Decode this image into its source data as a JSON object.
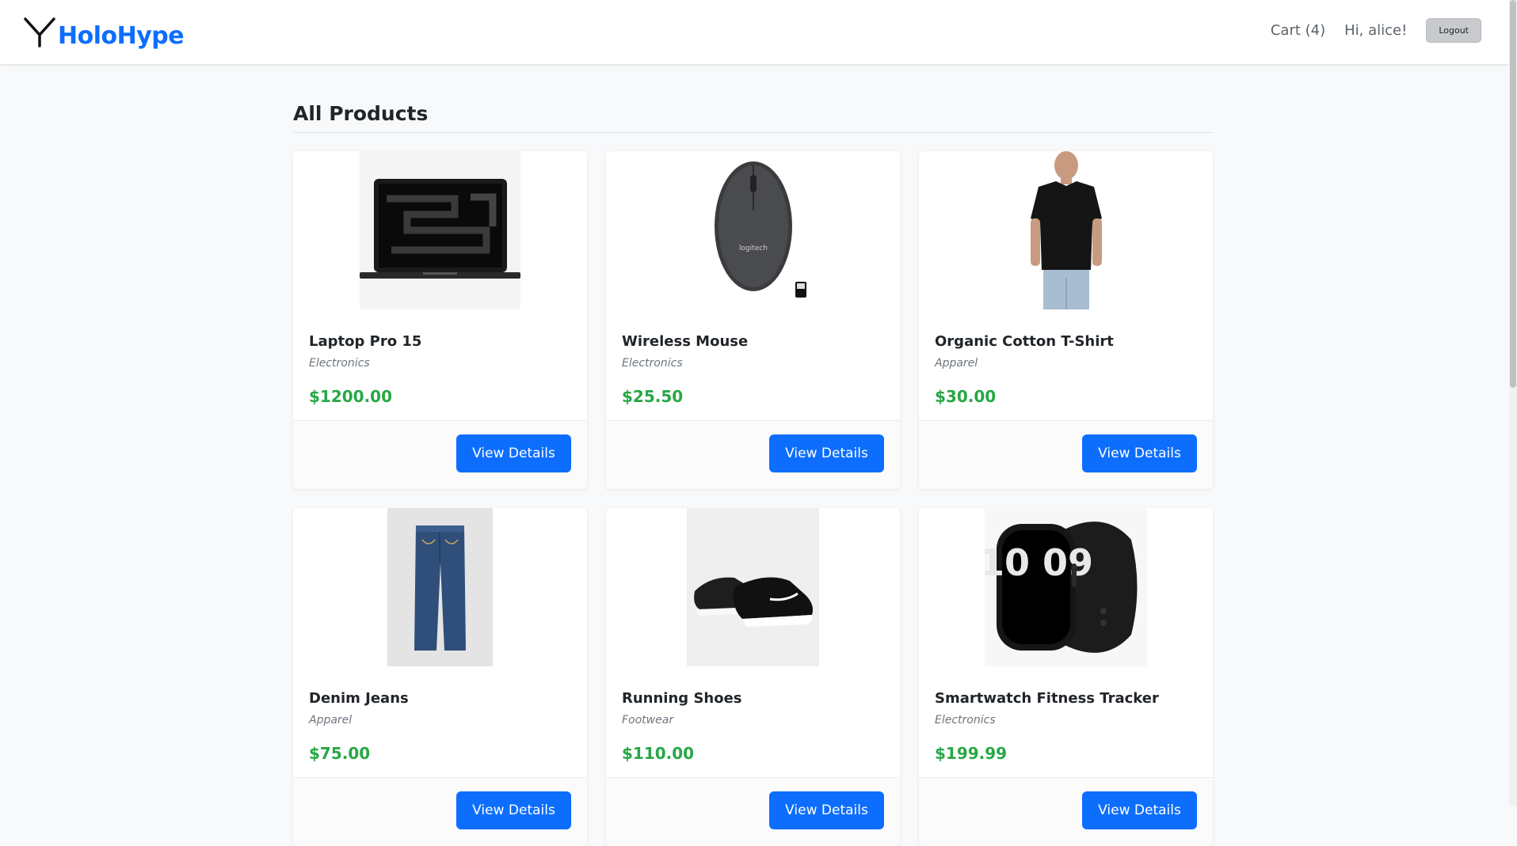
{
  "brand": {
    "name": "HoloHype",
    "accent": "#0d6efd"
  },
  "nav": {
    "cart_label": "Cart (4)",
    "greeting": "Hi, alice!",
    "logout_label": "Logout"
  },
  "main": {
    "title": "All Products",
    "products": [
      {
        "name": "Laptop Pro 15",
        "category": "Electronics",
        "price": "$1200.00",
        "button": "View Details",
        "image_icon": "laptop-image"
      },
      {
        "name": "Wireless Mouse",
        "category": "Electronics",
        "price": "$25.50",
        "button": "View Details",
        "image_icon": "mouse-image"
      },
      {
        "name": "Organic Cotton T-Shirt",
        "category": "Apparel",
        "price": "$30.00",
        "button": "View Details",
        "image_icon": "tshirt-image"
      },
      {
        "name": "Denim Jeans",
        "category": "Apparel",
        "price": "$75.00",
        "button": "View Details",
        "image_icon": "jeans-image"
      },
      {
        "name": "Running Shoes",
        "category": "Footwear",
        "price": "$110.00",
        "button": "View Details",
        "image_icon": "shoes-image"
      },
      {
        "name": "Smartwatch Fitness Tracker",
        "category": "Electronics",
        "price": "$199.99",
        "button": "View Details",
        "image_icon": "smartwatch-image"
      }
    ]
  },
  "colors": {
    "price": "#28a745",
    "button": "#0d6efd",
    "background": "#f8f9fa"
  },
  "product_image_text": {
    "mouse_brand": "logitech",
    "watch_time": "10 09"
  }
}
